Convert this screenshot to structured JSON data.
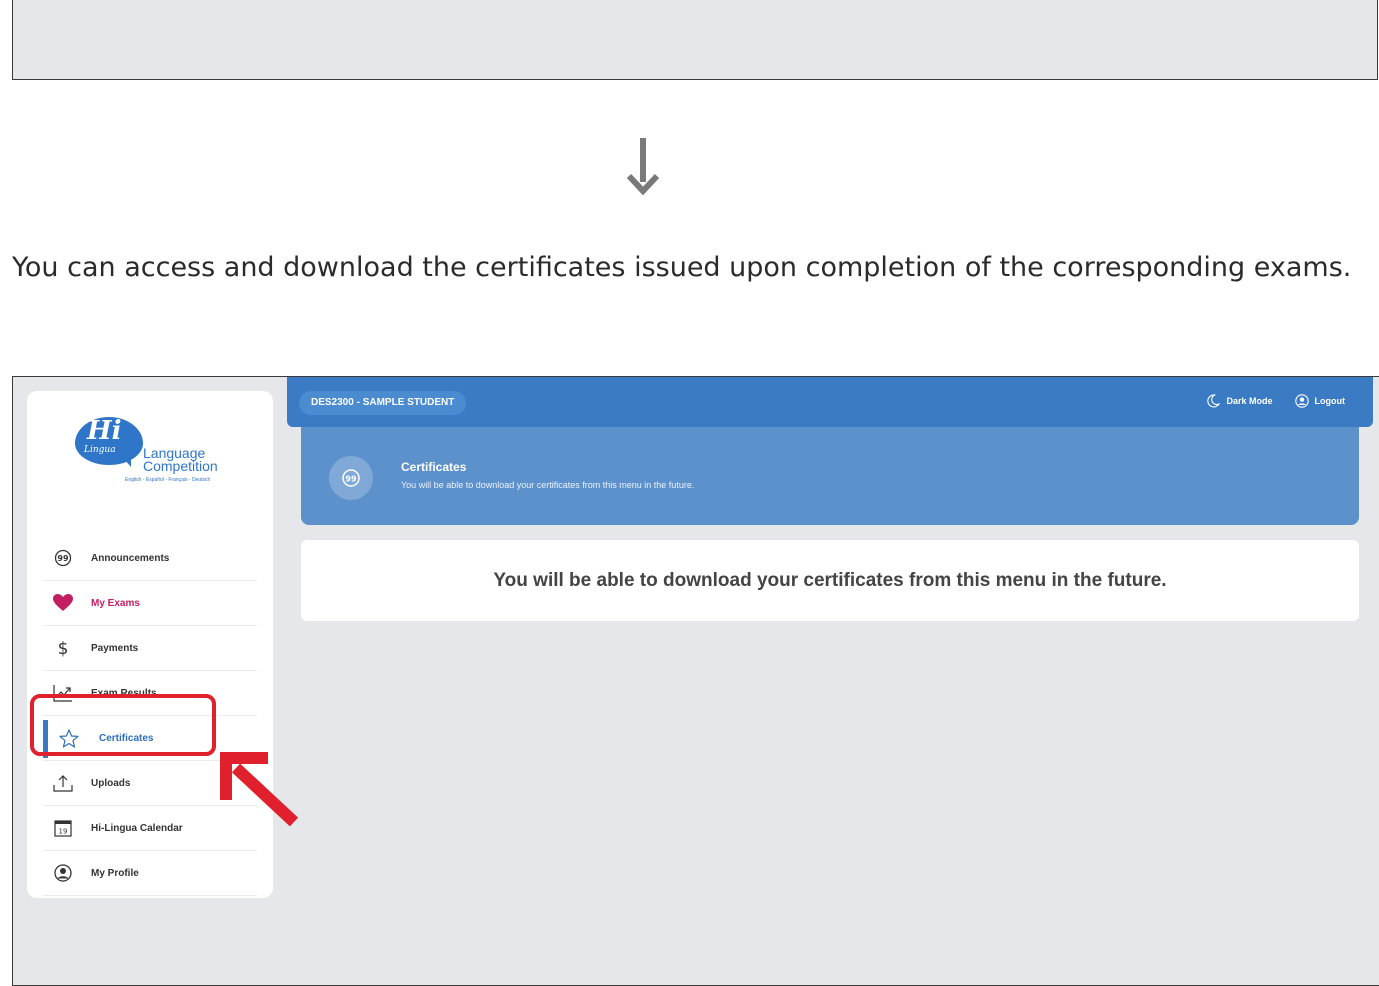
{
  "instruction": "You can access and download the certificates issued upon completion of the corresponding exams.",
  "logo": {
    "hi": "Hi",
    "lingua": "Lingua",
    "name": "Language Competition",
    "languages": "English - Español - Français - Deutsch"
  },
  "sidebar": {
    "items": [
      {
        "label": "Announcements",
        "icon": "chat-bubble-icon"
      },
      {
        "label": "My Exams",
        "icon": "heart-icon"
      },
      {
        "label": "Payments",
        "icon": "dollar-icon"
      },
      {
        "label": "Exam Results",
        "icon": "trend-chart-icon"
      },
      {
        "label": "Certificates",
        "icon": "star-icon"
      },
      {
        "label": "Uploads",
        "icon": "upload-icon"
      },
      {
        "label": "Hi-Lingua Calendar",
        "icon": "calendar-icon"
      },
      {
        "label": "My Profile",
        "icon": "user-circle-icon"
      }
    ],
    "active_index": 4
  },
  "calendar_day": "19",
  "topbar": {
    "student": "DES2300 - SAMPLE STUDENT",
    "dark_mode": "Dark Mode",
    "logout": "Logout"
  },
  "header": {
    "title": "Certificates",
    "subtitle": "You will be able to download your certificates from this menu in the future."
  },
  "main": {
    "message": "You will be able to download your certificates from this menu in the future."
  },
  "colors": {
    "primary": "#3a7bc4",
    "header": "#5d91cb",
    "accent_pink": "#c21e62",
    "annotation_red": "#e0202c"
  }
}
